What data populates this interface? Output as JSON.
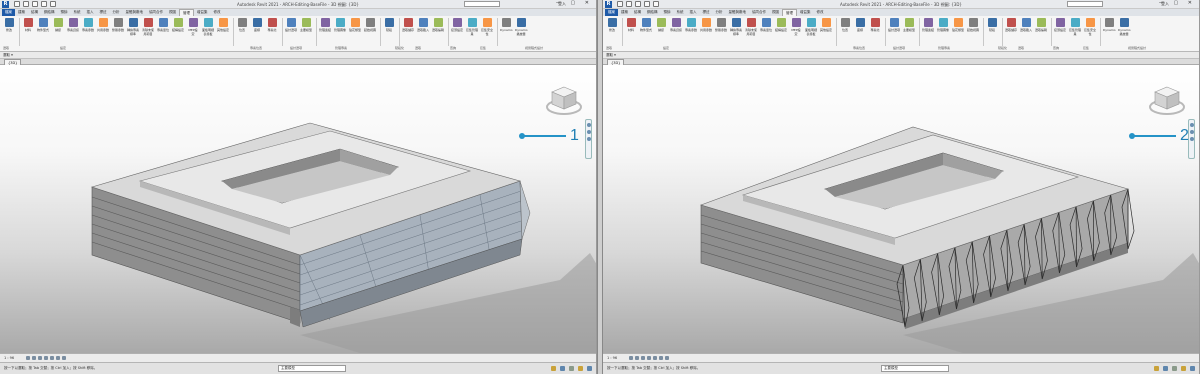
{
  "left": {
    "window_title": "Autodesk Revit 2021 - ARCH-Editing-BaseFile - 3D 視圖: {3D}",
    "user": "登入",
    "ribbon_tabs": [
      "檔案",
      "建築",
      "結構",
      "鋼結構",
      "預鑄",
      "系統",
      "插入",
      "標註",
      "分析",
      "量體與敷地",
      "協同合作",
      "視圖",
      "管理",
      "增益集",
      "修改"
    ],
    "active_tab_index": 12,
    "ribbon_buttons": [
      "修改",
      "材料",
      "物件型式",
      "捕捉",
      "專案資訊",
      "專案參數",
      "共用參數",
      "整體參數",
      "轉換專案標準",
      "清除未使用項目",
      "專案單位",
      "結構設定",
      "MEP設定",
      "面板明細表樣板",
      "其他設定",
      "位置",
      "座標",
      "專案北",
      "設計選項",
      "主要模型",
      "管理連結",
      "管理圖像",
      "貼花類型",
      "起始視圖",
      "階段",
      "選取儲存",
      "選取載入",
      "選取編輯",
      "接頭設定",
      "巨集管理員",
      "巨集安全性",
      "Dynamo",
      "Dynamo播放器"
    ],
    "ribbon_groups": [
      "選取",
      "設定",
      "專案位置",
      "設計選項",
      "管理專案",
      "階段化",
      "選取",
      "查詢",
      "巨集",
      "視覺程式設計"
    ],
    "subbar_text": "選取 ▾",
    "view_tab": "{3D}",
    "callout_number": "1",
    "view_scale": "1 : 96",
    "status_message": "按一下以選取；按 Tab 交替；按 Ctrl 加入；按 Shift 移除。",
    "status_model": "主要模型"
  },
  "right": {
    "window_title": "Autodesk Revit 2021 - ARCH-Editing-BaseFile - 3D 視圖: {3D}",
    "user": "登入",
    "ribbon_tabs": [
      "檔案",
      "建築",
      "結構",
      "鋼結構",
      "預鑄",
      "系統",
      "插入",
      "標註",
      "分析",
      "量體與敷地",
      "協同合作",
      "視圖",
      "管理",
      "增益集",
      "修改"
    ],
    "active_tab_index": 12,
    "ribbon_buttons": [
      "修改",
      "材料",
      "物件型式",
      "捕捉",
      "專案資訊",
      "專案參數",
      "共用參數",
      "整體參數",
      "轉換專案標準",
      "清除未使用項目",
      "專案單位",
      "結構設定",
      "MEP設定",
      "面板明細表樣板",
      "其他設定",
      "位置",
      "座標",
      "專案北",
      "設計選項",
      "主要模型",
      "管理連結",
      "管理圖像",
      "貼花類型",
      "起始視圖",
      "階段",
      "選取儲存",
      "選取載入",
      "選取編輯",
      "接頭設定",
      "巨集管理員",
      "巨集安全性",
      "Dynamo",
      "Dynamo播放器"
    ],
    "ribbon_groups": [
      "選取",
      "設定",
      "專案位置",
      "設計選項",
      "管理專案",
      "階段化",
      "選取",
      "查詢",
      "巨集",
      "視覺程式設計"
    ],
    "subbar_text": "選取 ▾",
    "view_tab": "{3D}",
    "callout_number": "2",
    "view_scale": "1 : 96",
    "status_message": "按一下以選取；按 Tab 交替；按 Ctrl 加入；按 Shift 移除。",
    "status_model": "主要模型"
  },
  "colors": {
    "file_tab": "#1e5aa8",
    "callout": "#2593c7",
    "roof": "#dcdcdc",
    "wall_dark": "#8c8c8c",
    "glass": "#a9b4c0"
  },
  "icons": [
    "revit-logo-icon",
    "open-icon",
    "save-icon",
    "undo-icon",
    "redo-icon",
    "print-icon",
    "search-icon",
    "user-icon",
    "minimize-icon",
    "maximize-icon",
    "close-icon",
    "viewcube-icon",
    "navigation-wheel-icon",
    "zoom-icon",
    "warning-icon",
    "worksets-icon",
    "filter-icon"
  ]
}
